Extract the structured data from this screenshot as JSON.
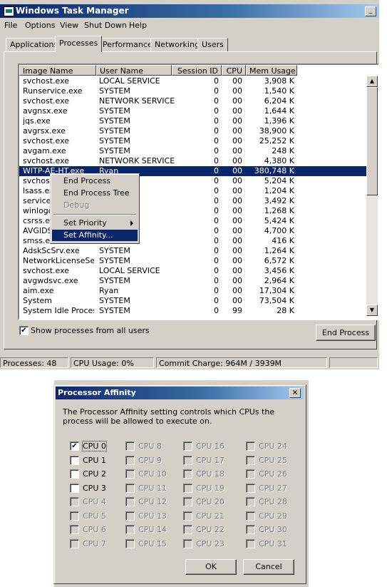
{
  "window": {
    "title": "Windows Task Manager",
    "minimize_glyph": "_"
  },
  "menu": [
    "File",
    "Options",
    "View",
    "Shut Down",
    "Help"
  ],
  "tabs": [
    "Applications",
    "Processes",
    "Performance",
    "Networking",
    "Users"
  ],
  "active_tab": "Processes",
  "columns": [
    "Image Name",
    "User Name",
    "Session ID",
    "CPU",
    "Mem Usage"
  ],
  "rows": [
    [
      "svchost.exe",
      "LOCAL SERVICE",
      "0",
      "00",
      "3,908 K"
    ],
    [
      "Runservice.exe",
      "SYSTEM",
      "0",
      "00",
      "1,540 K"
    ],
    [
      "svchost.exe",
      "NETWORK SERVICE",
      "0",
      "00",
      "6,204 K"
    ],
    [
      "avgnsx.exe",
      "SYSTEM",
      "0",
      "00",
      "1,644 K"
    ],
    [
      "jqs.exe",
      "SYSTEM",
      "0",
      "00",
      "1,396 K"
    ],
    [
      "avgrsx.exe",
      "SYSTEM",
      "0",
      "00",
      "38,900 K"
    ],
    [
      "svchost.exe",
      "SYSTEM",
      "0",
      "00",
      "25,252 K"
    ],
    [
      "avgam.exe",
      "SYSTEM",
      "0",
      "00",
      "248 K"
    ],
    [
      "svchost.exe",
      "NETWORK SERVICE",
      "0",
      "00",
      "4,380 K"
    ],
    [
      "WITP-AE-HT.exe",
      "Ryan",
      "0",
      "00",
      "380,748 K"
    ],
    [
      "svchost",
      "",
      "0",
      "00",
      "5,204 K"
    ],
    [
      "lsass.ex",
      "",
      "0",
      "00",
      "1,204 K"
    ],
    [
      "services",
      "",
      "0",
      "00",
      "3,492 K"
    ],
    [
      "winlogo",
      "",
      "0",
      "00",
      "1,268 K"
    ],
    [
      "csrss.ex",
      "",
      "0",
      "00",
      "5,424 K"
    ],
    [
      "AVGIDS",
      "",
      "0",
      "00",
      "4,700 K"
    ],
    [
      "smss.ex",
      "",
      "0",
      "00",
      "416 K"
    ],
    [
      "AdskScSrv.exe",
      "SYSTEM",
      "0",
      "00",
      "1,264 K"
    ],
    [
      "NetworkLicenseSe...",
      "SYSTEM",
      "0",
      "00",
      "6,572 K"
    ],
    [
      "svchost.exe",
      "LOCAL SERVICE",
      "0",
      "00",
      "3,456 K"
    ],
    [
      "avgwdsvc.exe",
      "SYSTEM",
      "0",
      "00",
      "2,964 K"
    ],
    [
      "aim.exe",
      "Ryan",
      "0",
      "00",
      "17,304 K"
    ],
    [
      "System",
      "SYSTEM",
      "0",
      "00",
      "73,504 K"
    ],
    [
      "System Idle Process",
      "SYSTEM",
      "0",
      "99",
      "28 K"
    ]
  ],
  "selected_row": 9,
  "context_menu": {
    "items": [
      "End Process",
      "End Process Tree",
      "Debug",
      "Set Priority",
      "Set Affinity..."
    ],
    "disabled": [
      "Debug"
    ],
    "highlighted": "Set Affinity..."
  },
  "show_all_users": {
    "label": "Show processes from all users",
    "checked": true,
    "check_glyph": "✔"
  },
  "end_process_button": "End Process",
  "status": {
    "processes": "Processes: 48",
    "cpu_usage": "CPU Usage: 0%",
    "commit_charge": "Commit Charge: 964M / 3939M"
  },
  "affinity_dialog": {
    "title": "Processor Affinity",
    "close_glyph": "✕",
    "description": "The Processor Affinity setting controls which CPUs the process will be allowed to execute on.",
    "cpus": [
      "CPU 0",
      "CPU 1",
      "CPU 2",
      "CPU 3",
      "CPU 4",
      "CPU 5",
      "CPU 6",
      "CPU 7",
      "CPU 8",
      "CPU 9",
      "CPU 10",
      "CPU 11",
      "CPU 12",
      "CPU 13",
      "CPU 14",
      "CPU 15",
      "CPU 16",
      "CPU 17",
      "CPU 18",
      "CPU 19",
      "CPU 20",
      "CPU 21",
      "CPU 22",
      "CPU 23",
      "CPU 24",
      "CPU 25",
      "CPU 26",
      "CPU 27",
      "CPU 28",
      "CPU 29",
      "CPU 30",
      "CPU 31"
    ],
    "enabled_cpus": [
      "CPU 0",
      "CPU 1",
      "CPU 2",
      "CPU 3"
    ],
    "checked_cpus": [
      "CPU 0"
    ],
    "ok": "OK",
    "cancel": "Cancel"
  }
}
